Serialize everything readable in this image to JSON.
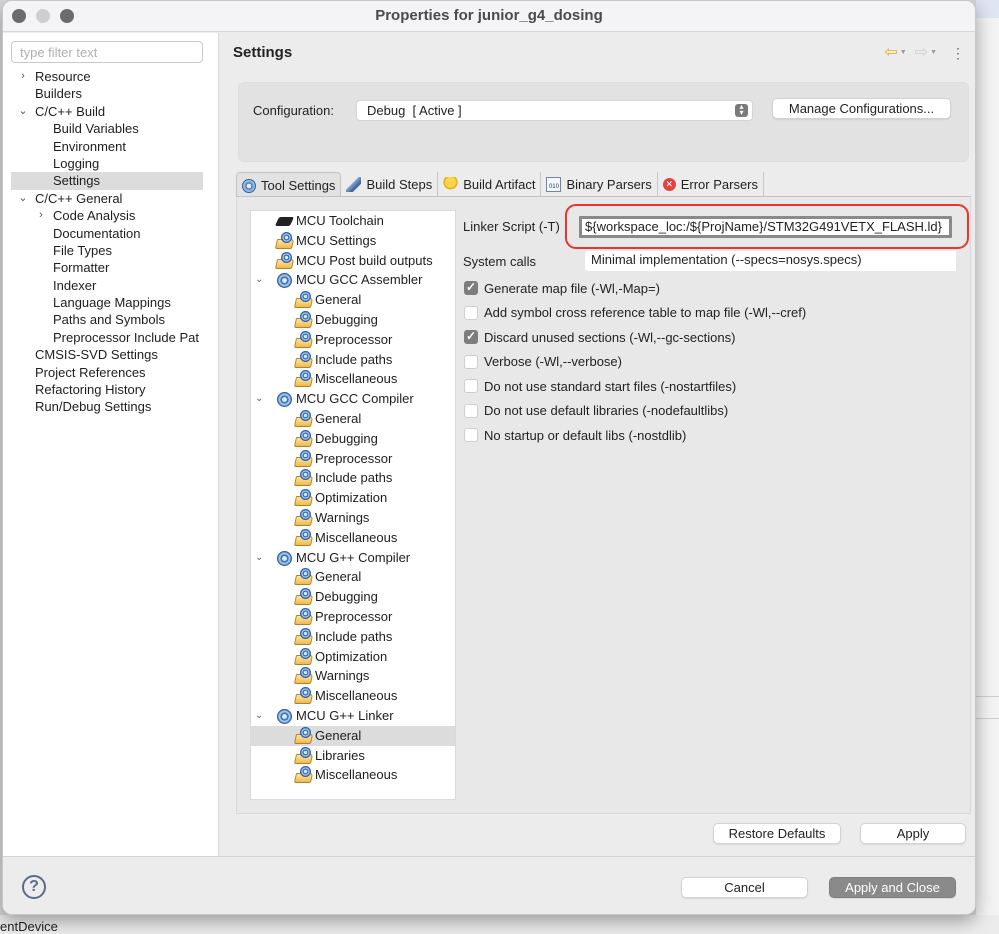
{
  "window": {
    "title": "Properties for junior_g4_dosing"
  },
  "left_nav": {
    "filter_placeholder": "type filter text",
    "items": [
      {
        "label": "Resource",
        "level": 0,
        "chevron": "›"
      },
      {
        "label": "Builders",
        "level": 0,
        "chevron": ""
      },
      {
        "label": "C/C++ Build",
        "level": 0,
        "chevron": "⌄"
      },
      {
        "label": "Build Variables",
        "level": 1,
        "chevron": ""
      },
      {
        "label": "Environment",
        "level": 1,
        "chevron": ""
      },
      {
        "label": "Logging",
        "level": 1,
        "chevron": ""
      },
      {
        "label": "Settings",
        "level": 1,
        "chevron": "",
        "selected": true
      },
      {
        "label": "C/C++ General",
        "level": 0,
        "chevron": "⌄"
      },
      {
        "label": "Code Analysis",
        "level": 1,
        "chevron": "›"
      },
      {
        "label": "Documentation",
        "level": 1,
        "chevron": ""
      },
      {
        "label": "File Types",
        "level": 1,
        "chevron": ""
      },
      {
        "label": "Formatter",
        "level": 1,
        "chevron": ""
      },
      {
        "label": "Indexer",
        "level": 1,
        "chevron": ""
      },
      {
        "label": "Language Mappings",
        "level": 1,
        "chevron": ""
      },
      {
        "label": "Paths and Symbols",
        "level": 1,
        "chevron": ""
      },
      {
        "label": "Preprocessor Include Pat",
        "level": 1,
        "chevron": ""
      },
      {
        "label": "CMSIS-SVD Settings",
        "level": 0,
        "chevron": ""
      },
      {
        "label": "Project References",
        "level": 0,
        "chevron": ""
      },
      {
        "label": "Refactoring History",
        "level": 0,
        "chevron": ""
      },
      {
        "label": "Run/Debug Settings",
        "level": 0,
        "chevron": ""
      }
    ]
  },
  "settings": {
    "title": "Settings",
    "nav_icons": {
      "back": "back-arrow-icon",
      "forward": "forward-arrow-icon",
      "menu": "view-menu-icon"
    },
    "configuration_label": "Configuration:",
    "configuration_value": "Debug  [ Active ]",
    "manage_button": "Manage Configurations...",
    "tabs": [
      {
        "label": "Tool Settings",
        "icon": "tool-settings-icon",
        "active": true
      },
      {
        "label": "Build Steps",
        "icon": "build-steps-icon"
      },
      {
        "label": "Build Artifact",
        "icon": "build-artifact-icon"
      },
      {
        "label": "Binary Parsers",
        "icon": "binary-parsers-icon"
      },
      {
        "label": "Error Parsers",
        "icon": "error-parsers-icon"
      }
    ],
    "tool_tree": [
      {
        "label": "MCU Toolchain",
        "level": 0,
        "icon": "chip"
      },
      {
        "label": "MCU Settings",
        "level": 0,
        "icon": "folder-gear"
      },
      {
        "label": "MCU Post build outputs",
        "level": 0,
        "icon": "folder-gear"
      },
      {
        "label": "MCU GCC Assembler",
        "level": 0,
        "icon": "gear",
        "expanded": true
      },
      {
        "label": "General",
        "level": 1,
        "icon": "folder-gear"
      },
      {
        "label": "Debugging",
        "level": 1,
        "icon": "folder-gear"
      },
      {
        "label": "Preprocessor",
        "level": 1,
        "icon": "folder-gear"
      },
      {
        "label": "Include paths",
        "level": 1,
        "icon": "folder-gear"
      },
      {
        "label": "Miscellaneous",
        "level": 1,
        "icon": "folder-gear"
      },
      {
        "label": "MCU GCC Compiler",
        "level": 0,
        "icon": "gear",
        "expanded": true
      },
      {
        "label": "General",
        "level": 1,
        "icon": "folder-gear"
      },
      {
        "label": "Debugging",
        "level": 1,
        "icon": "folder-gear"
      },
      {
        "label": "Preprocessor",
        "level": 1,
        "icon": "folder-gear"
      },
      {
        "label": "Include paths",
        "level": 1,
        "icon": "folder-gear"
      },
      {
        "label": "Optimization",
        "level": 1,
        "icon": "folder-gear"
      },
      {
        "label": "Warnings",
        "level": 1,
        "icon": "folder-gear"
      },
      {
        "label": "Miscellaneous",
        "level": 1,
        "icon": "folder-gear"
      },
      {
        "label": "MCU G++ Compiler",
        "level": 0,
        "icon": "gear",
        "expanded": true
      },
      {
        "label": "General",
        "level": 1,
        "icon": "folder-gear"
      },
      {
        "label": "Debugging",
        "level": 1,
        "icon": "folder-gear"
      },
      {
        "label": "Preprocessor",
        "level": 1,
        "icon": "folder-gear"
      },
      {
        "label": "Include paths",
        "level": 1,
        "icon": "folder-gear"
      },
      {
        "label": "Optimization",
        "level": 1,
        "icon": "folder-gear"
      },
      {
        "label": "Warnings",
        "level": 1,
        "icon": "folder-gear"
      },
      {
        "label": "Miscellaneous",
        "level": 1,
        "icon": "folder-gear"
      },
      {
        "label": "MCU G++ Linker",
        "level": 0,
        "icon": "gear",
        "expanded": true
      },
      {
        "label": "General",
        "level": 1,
        "icon": "folder-gear",
        "selected": true
      },
      {
        "label": "Libraries",
        "level": 1,
        "icon": "folder-gear"
      },
      {
        "label": "Miscellaneous",
        "level": 1,
        "icon": "folder-gear"
      }
    ],
    "linker_script_label": "Linker Script (-T)",
    "linker_script_value": "${workspace_loc:/${ProjName}/STM32G491VETX_FLASH.ld}",
    "system_calls_label": "System calls",
    "system_calls_value": "Minimal implementation (--specs=nosys.specs)",
    "options": [
      {
        "label": "Generate map file (-Wl,-Map=)",
        "checked": true
      },
      {
        "label": "Add symbol cross reference table to map file (-Wl,--cref)",
        "checked": false
      },
      {
        "label": "Discard unused sections (-Wl,--gc-sections)",
        "checked": true
      },
      {
        "label": "Verbose (-Wl,--verbose)",
        "checked": false
      },
      {
        "label": "Do not use standard start files (-nostartfiles)",
        "checked": false
      },
      {
        "label": "Do not use default libraries (-nodefaultlibs)",
        "checked": false
      },
      {
        "label": "No startup or default libs (-nostdlib)",
        "checked": false
      }
    ],
    "restore_defaults": "Restore Defaults",
    "apply": "Apply"
  },
  "footer": {
    "help": "?",
    "cancel": "Cancel",
    "apply_and_close": "Apply and Close"
  },
  "background": {
    "partial_text": "entDevice"
  },
  "colors": {
    "highlight_ring": "#e8362a",
    "selected_row": "#dcdcdc",
    "primary_button": "#8a8a8a"
  }
}
